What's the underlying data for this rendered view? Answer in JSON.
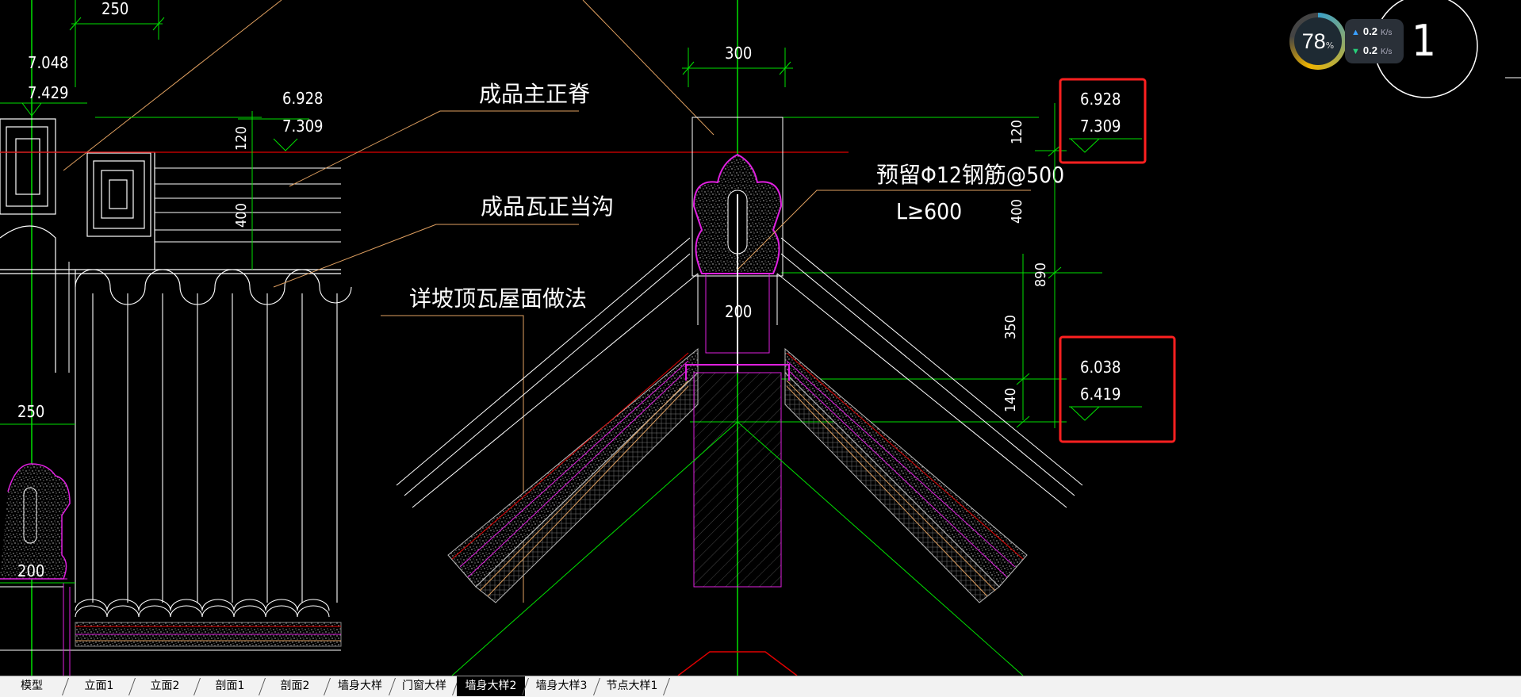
{
  "drawing": {
    "left_detail": {
      "dim_top": "250",
      "elev_a": "7.048",
      "elev_b": "7.429",
      "elev_c": "6.928",
      "elev_d": "7.309",
      "dim_120": "120",
      "dim_400": "400",
      "dim_250": "250",
      "dim_200": "200"
    },
    "leaders": {
      "main_ridge": "成品主正脊",
      "tile_ridge": "成品瓦正当沟",
      "roof_ref": "详坡顶瓦屋面做法",
      "rebar_line1": "预留Φ12钢筋@500",
      "rebar_line2": "L≥600"
    },
    "center_detail": {
      "dim_300": "300",
      "dim_200": "200"
    },
    "right_dims": {
      "dim_120": "120",
      "dim_400": "400",
      "dim_890": "890",
      "dim_350": "350",
      "dim_140": "140",
      "elev_upper_1": "6.928",
      "elev_upper_2": "7.309",
      "elev_lower_1": "6.038",
      "elev_lower_2": "6.419"
    },
    "corner_numeral": "1",
    "colors": {
      "dim": "#00e000",
      "leader": "#e0a060",
      "outline": "#ffffff",
      "magenta": "#e020e0",
      "red": "#e00000",
      "highlight_box": "#ff2020"
    }
  },
  "network_widget": {
    "percent_value": "78",
    "percent_unit": "%",
    "upload_value": "0.2",
    "upload_unit": "K/s",
    "download_value": "0.2",
    "download_unit": "K/s"
  },
  "tabs": [
    {
      "label": "模型",
      "active": false
    },
    {
      "label": "立面1",
      "active": false
    },
    {
      "label": "立面2",
      "active": false
    },
    {
      "label": "剖面1",
      "active": false
    },
    {
      "label": "剖面2",
      "active": false
    },
    {
      "label": "墙身大样",
      "active": false
    },
    {
      "label": "门窗大样",
      "active": false
    },
    {
      "label": "墙身大样2",
      "active": true
    },
    {
      "label": "墙身大样3",
      "active": false
    },
    {
      "label": "节点大样1",
      "active": false
    }
  ]
}
